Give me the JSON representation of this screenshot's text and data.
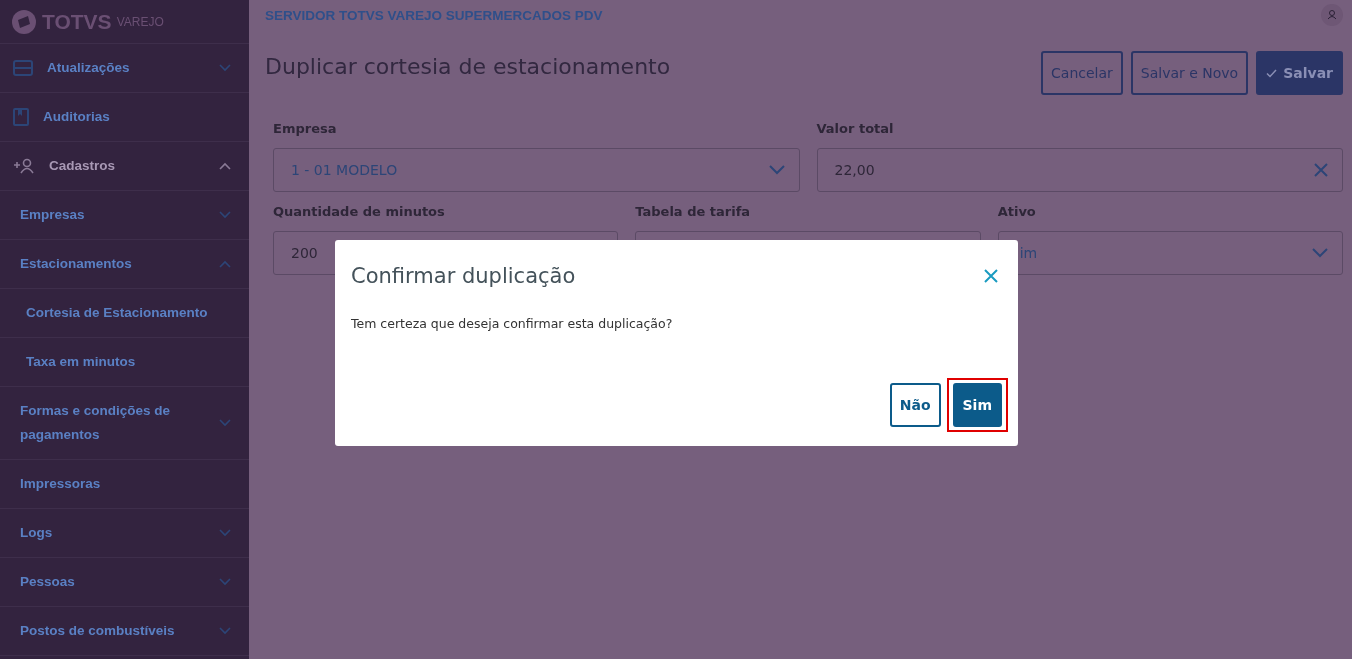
{
  "logo": {
    "brand": "TOTVS",
    "product": "VAREJO"
  },
  "sidebar": {
    "items": [
      {
        "label": "Atualizações",
        "expanded": false
      },
      {
        "label": "Auditorias"
      },
      {
        "label": "Cadastros",
        "expanded": true,
        "children": [
          {
            "label": "Empresas",
            "expanded": false
          },
          {
            "label": "Estacionamentos",
            "expanded": true,
            "children": [
              {
                "label": "Cortesia de Estacionamento"
              },
              {
                "label": "Taxa em minutos"
              }
            ]
          },
          {
            "label": "Formas e condições de pagamentos",
            "expanded": false
          },
          {
            "label": "Impressoras"
          },
          {
            "label": "Logs",
            "expanded": false
          },
          {
            "label": "Pessoas",
            "expanded": false
          },
          {
            "label": "Postos de combustíveis",
            "expanded": false
          }
        ]
      }
    ]
  },
  "header": {
    "server": "SERVIDOR TOTVS VAREJO SUPERMERCADOS PDV"
  },
  "page": {
    "title": "Duplicar cortesia de estacionamento",
    "actions": [
      {
        "label": "Cancelar",
        "kind": "outline"
      },
      {
        "label": "Salvar e Novo",
        "kind": "outline"
      },
      {
        "label": "Salvar",
        "kind": "primary"
      }
    ]
  },
  "form": {
    "rows": [
      [
        {
          "label": "Empresa",
          "value": "1 - 01 MODELO",
          "kind": "select"
        },
        {
          "label": "Valor total",
          "value": "22,00",
          "kind": "clearable"
        }
      ],
      [
        {
          "label": "Quantidade de minutos",
          "value": "200",
          "kind": "text"
        },
        {
          "label": "Tabela de tarifa",
          "kind": "text"
        },
        {
          "label": "Ativo",
          "value": "im",
          "kind": "select"
        }
      ]
    ]
  },
  "dialog": {
    "title": "Confirmar duplicação",
    "message": "Tem certeza que deseja confirmar esta duplicação?",
    "buttons": [
      {
        "label": "Não",
        "kind": "outline",
        "highlighted": false
      },
      {
        "label": "Sim",
        "kind": "primary",
        "highlighted": true
      }
    ]
  }
}
